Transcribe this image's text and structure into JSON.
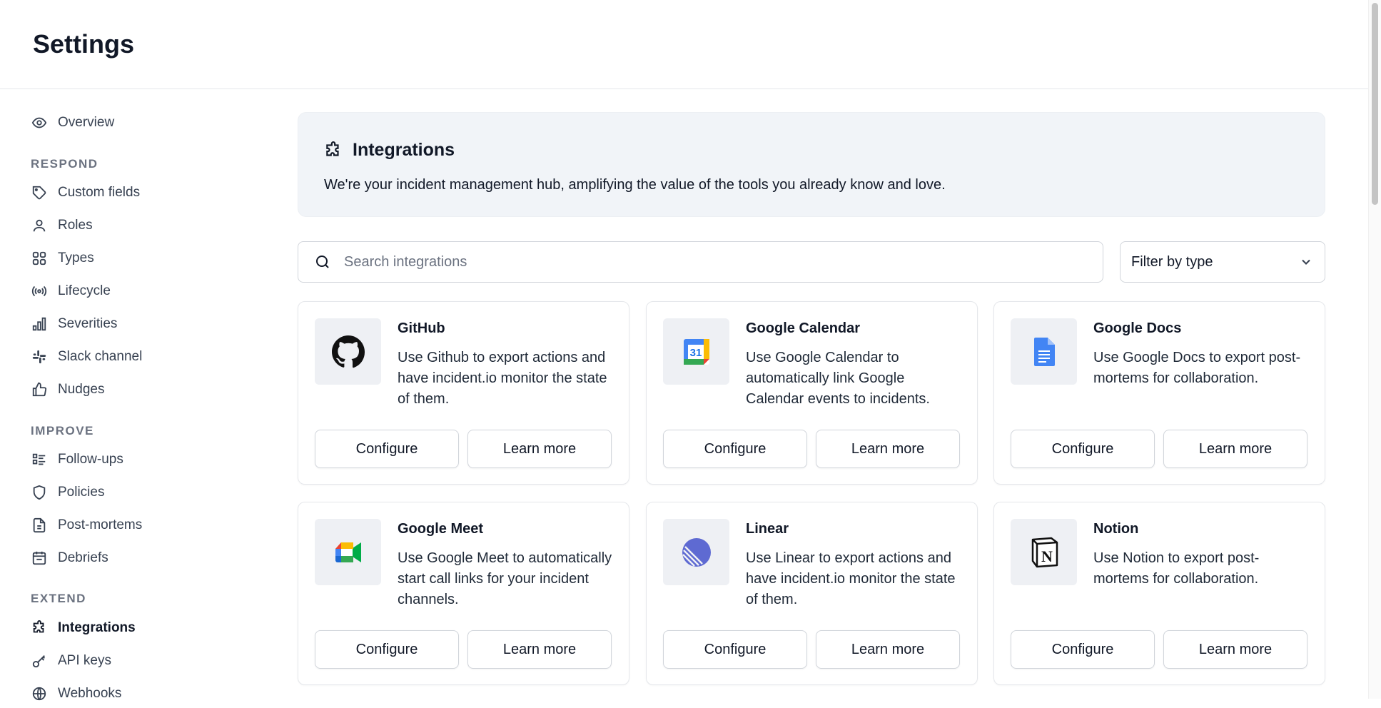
{
  "header": {
    "title": "Settings"
  },
  "sidebar": {
    "overview": {
      "label": "Overview",
      "icon": "eye-icon"
    },
    "sections": [
      {
        "label": "RESPOND",
        "items": [
          {
            "label": "Custom fields",
            "icon": "tag-icon"
          },
          {
            "label": "Roles",
            "icon": "user-icon"
          },
          {
            "label": "Types",
            "icon": "grid-icon"
          },
          {
            "label": "Lifecycle",
            "icon": "broadcast-icon"
          },
          {
            "label": "Severities",
            "icon": "bar-chart-icon"
          },
          {
            "label": "Slack channel",
            "icon": "slack-icon"
          },
          {
            "label": "Nudges",
            "icon": "thumbs-up-icon"
          }
        ]
      },
      {
        "label": "IMPROVE",
        "items": [
          {
            "label": "Follow-ups",
            "icon": "checklist-icon"
          },
          {
            "label": "Policies",
            "icon": "shield-icon"
          },
          {
            "label": "Post-mortems",
            "icon": "document-icon"
          },
          {
            "label": "Debriefs",
            "icon": "calendar-icon"
          }
        ]
      },
      {
        "label": "EXTEND",
        "items": [
          {
            "label": "Integrations",
            "icon": "puzzle-icon",
            "active": true
          },
          {
            "label": "API keys",
            "icon": "key-icon"
          },
          {
            "label": "Webhooks",
            "icon": "globe-icon"
          }
        ]
      }
    ]
  },
  "hero": {
    "title": "Integrations",
    "description": "We're your incident management hub, amplifying the value of the tools you already know and love."
  },
  "search": {
    "placeholder": "Search integrations",
    "value": ""
  },
  "filter": {
    "label": "Filter by type"
  },
  "buttons": {
    "configure": "Configure",
    "learn_more": "Learn more"
  },
  "integrations": [
    {
      "name": "GitHub",
      "description": "Use Github to export actions and have incident.io monitor the state of them.",
      "icon": "github-icon"
    },
    {
      "name": "Google Calendar",
      "description": "Use Google Calendar to automatically link Google Calendar events to incidents.",
      "icon": "google-calendar-icon",
      "badge": "31"
    },
    {
      "name": "Google Docs",
      "description": "Use Google Docs to export post-mortems for collaboration.",
      "icon": "google-docs-icon"
    },
    {
      "name": "Google Meet",
      "description": "Use Google Meet to automatically start call links for your incident channels.",
      "icon": "google-meet-icon"
    },
    {
      "name": "Linear",
      "description": "Use Linear to export actions and have incident.io monitor the state of them.",
      "icon": "linear-icon"
    },
    {
      "name": "Notion",
      "description": "Use Notion to export post-mortems for collaboration.",
      "icon": "notion-icon",
      "badge": "N"
    }
  ],
  "colors": {
    "linear": "#5e6ad2",
    "google_blue": "#4285f4",
    "google_red": "#ea4335",
    "google_yellow": "#fbbc04",
    "google_green": "#34a853"
  }
}
